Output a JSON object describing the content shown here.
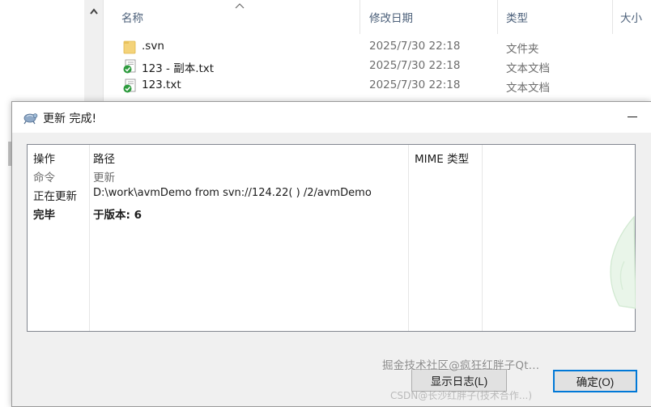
{
  "explorer": {
    "columns": {
      "name": "名称",
      "modified": "修改日期",
      "type": "类型",
      "size": "大小"
    },
    "files": [
      {
        "name": ".svn",
        "modified": "2025/7/30 22:18",
        "type": "文件夹",
        "icon": "folder-icon"
      },
      {
        "name": "123 - 副本.txt",
        "modified": "2025/7/30 22:18",
        "type": "文本文档",
        "icon": "svn-ok-text-file-icon"
      },
      {
        "name": "123.txt",
        "modified": "2025/7/30 22:18",
        "type": "文本文档",
        "icon": "svn-ok-text-file-icon"
      }
    ]
  },
  "dialog": {
    "title": "更新 完成!",
    "columns": {
      "action": "操作",
      "path": "路径",
      "mime": "MIME 类型"
    },
    "rows": [
      {
        "action": "命令",
        "path": "更新",
        "style": "gray"
      },
      {
        "action": "正在更新",
        "path": "D:\\work\\avmDemo from svn://124.22(  ) /2/avmDemo",
        "style": "normal"
      },
      {
        "action": "完毕",
        "path": "于版本: 6",
        "style": "bold"
      }
    ],
    "buttons": {
      "show_log": "显示日志(L)",
      "ok": "确定(O)"
    }
  },
  "watermark": {
    "line1": "掘金技术社区@疯狂红胖子Qt...",
    "line2": "CSDN@长沙红胖子(技术合作...)"
  },
  "colors": {
    "accent": "#0078d7",
    "svn_ok": "#2e9b3e",
    "folder": "#f4d37a"
  }
}
